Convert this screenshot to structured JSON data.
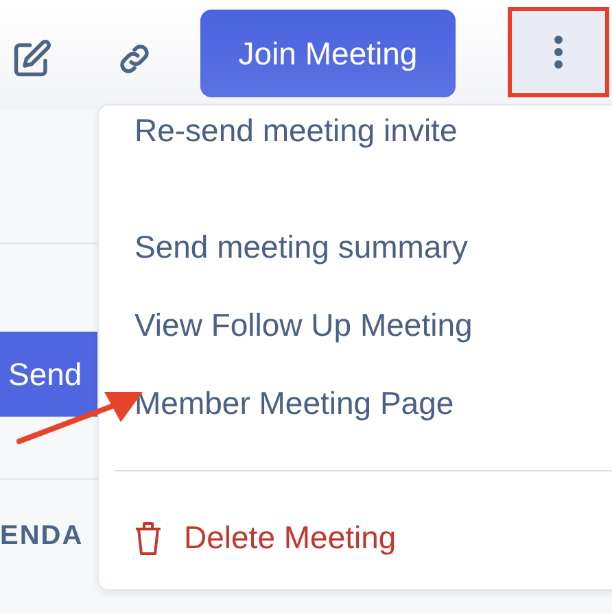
{
  "toolbar": {
    "join_button": "Join Meeting",
    "more_button": {
      "highlighted": true
    }
  },
  "background": {
    "send_button": "Send",
    "column_label": "ENDA"
  },
  "menu": {
    "items": [
      {
        "label": "Re-send meeting invite",
        "kind": "normal"
      },
      {
        "label": "Send meeting summary",
        "kind": "normal"
      },
      {
        "label": "View Follow Up Meeting",
        "kind": "normal"
      },
      {
        "label": "Member Meeting Page",
        "kind": "normal"
      },
      {
        "label": "Delete Meeting",
        "kind": "danger"
      }
    ]
  }
}
